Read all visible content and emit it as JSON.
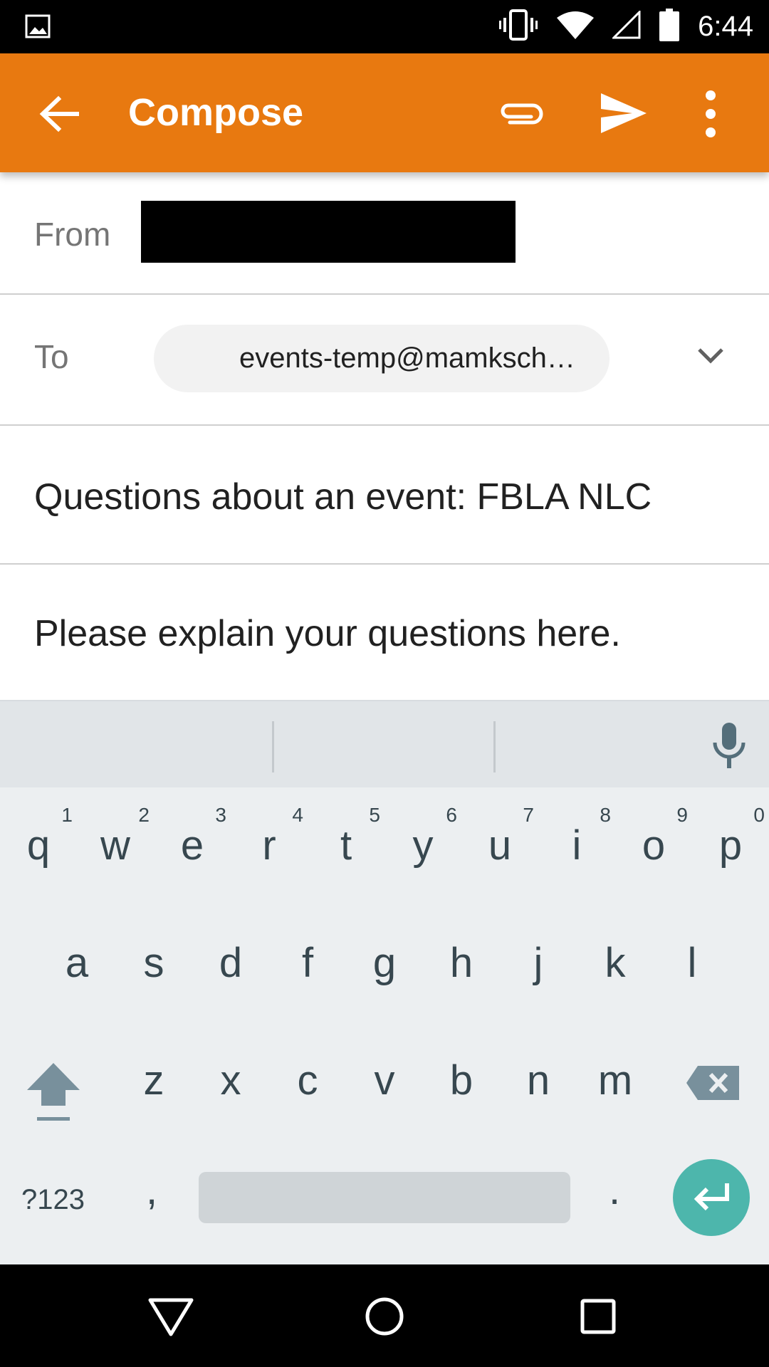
{
  "status_bar": {
    "time": "6:44",
    "icons": [
      "image-icon",
      "vibrate-icon",
      "wifi-icon",
      "signal-icon",
      "battery-icon"
    ]
  },
  "app_bar": {
    "title": "Compose",
    "color": "#e87910",
    "actions": [
      "back-arrow-icon",
      "attach-icon",
      "send-icon",
      "more-vert-icon"
    ]
  },
  "compose": {
    "from_label": "From",
    "from_value_redacted": true,
    "to_label": "To",
    "to_chip": "events-temp@mamksch…",
    "subject": "Questions about an event: FBLA NLC",
    "body": "Please explain your questions here."
  },
  "keyboard": {
    "row1": [
      {
        "ch": "q",
        "hint": "1"
      },
      {
        "ch": "w",
        "hint": "2"
      },
      {
        "ch": "e",
        "hint": "3"
      },
      {
        "ch": "r",
        "hint": "4"
      },
      {
        "ch": "t",
        "hint": "5"
      },
      {
        "ch": "y",
        "hint": "6"
      },
      {
        "ch": "u",
        "hint": "7"
      },
      {
        "ch": "i",
        "hint": "8"
      },
      {
        "ch": "o",
        "hint": "9"
      },
      {
        "ch": "p",
        "hint": "0"
      }
    ],
    "row2": [
      "a",
      "s",
      "d",
      "f",
      "g",
      "h",
      "j",
      "k",
      "l"
    ],
    "row3": [
      "z",
      "x",
      "c",
      "v",
      "b",
      "n",
      "m"
    ],
    "symbols_label": "?123",
    "comma": ",",
    "period": ".",
    "enter_color": "#4db6ac"
  },
  "nav_bar": {
    "icons": [
      "back-triangle-icon",
      "home-circle-icon",
      "recents-square-icon"
    ]
  }
}
